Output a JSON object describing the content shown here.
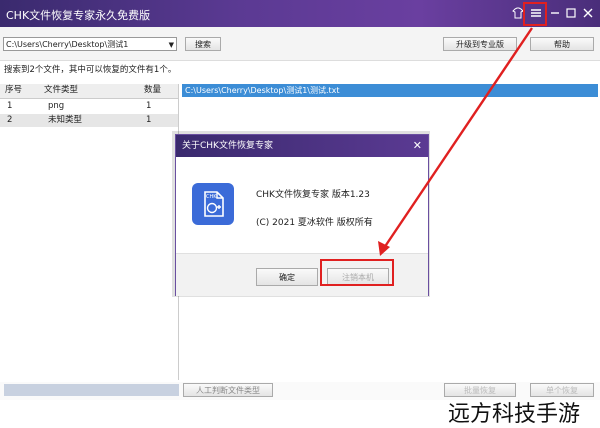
{
  "window": {
    "title": "CHK文件恢复专家永久免费版",
    "controls": {
      "skin_icon": "shirt-icon",
      "menu_icon": "menu-icon",
      "min_icon": "minimize-icon",
      "max_icon": "maximize-icon",
      "close_icon": "close-icon"
    }
  },
  "toolbar": {
    "path_value": "C:\\Users\\Cherry\\Desktop\\测试1",
    "search_label": "搜索",
    "upgrade_label": "升级到专业版",
    "help_label": "帮助"
  },
  "status_text": "搜索到2个文件，其中可以恢复的文件有1个。",
  "file_types_table": {
    "headers": [
      "序号",
      "文件类型",
      "数量"
    ],
    "rows": [
      [
        "1",
        "png",
        "1"
      ],
      [
        "2",
        "未知类型",
        "1"
      ]
    ]
  },
  "file_list": {
    "selected": "C:\\Users\\Cherry\\Desktop\\测试1\\测试.txt"
  },
  "bottom": {
    "manual_type_label": "人工判断文件类型",
    "batch_recover_label": "批量恢复",
    "single_recover_label": "单个恢复"
  },
  "about_dialog": {
    "title": "关于CHK文件恢复专家",
    "icon_label": "CHK",
    "version_text": "CHK文件恢复专家 版本1.23",
    "copyright_text": "(C) 2021 夏冰软件 版权所有",
    "ok_label": "确定",
    "unregister_label": "注销本机"
  },
  "watermark": "远方科技手游",
  "colors": {
    "title_bar": "#5b3a93",
    "selection": "#3c8dd6",
    "highlight": "#e02020",
    "app_icon": "#3b6bd8"
  }
}
